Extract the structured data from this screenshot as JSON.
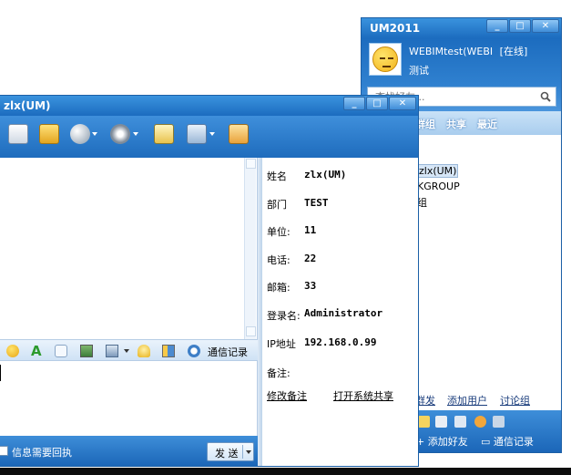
{
  "colors": {
    "title_blue": "#1c6cbf",
    "toolbar_blue": "#3f8fdb",
    "link": "#1a3d7c"
  },
  "um_window": {
    "title": "UM2011",
    "controls": [
      "_",
      "□",
      "✕"
    ],
    "user": {
      "name": "WEBIMtest(WEBI",
      "status": "[在线]",
      "signature": "测试"
    },
    "search_placeholder": "查找好友...",
    "tabs": [
      "群组",
      "共享",
      "最近"
    ],
    "tree": [
      {
        "label": "zlx(UM)",
        "selected": true
      },
      {
        "label": "KGROUP",
        "selected": false
      },
      {
        "label": "组",
        "selected": false
      }
    ],
    "links": [
      "群发",
      "添加用户",
      "讨论组"
    ],
    "bottom": {
      "add_friend": "添加好友",
      "chat_record": "通信记录"
    }
  },
  "chat_window": {
    "title": "zlx(UM)",
    "controls": [
      "_",
      "□",
      "✕"
    ],
    "toolbar_icons": [
      "document-icon",
      "folder-upload-icon",
      "magic-wand-icon",
      "webcam-icon",
      "whiteboard-icon",
      "remote-screen-icon",
      "add-contact-icon"
    ],
    "format_icons": [
      "emoticon-icon",
      "font-icon",
      "more-icon",
      "image-icon",
      "screenshot-icon",
      "bell-icon",
      "layout-icon",
      "history-icon"
    ],
    "chat_record_label": "通信记录",
    "receipt_label": "信息需要回执",
    "send_label": "发 送",
    "info": {
      "name_label": "姓名",
      "name_value": "zlx(UM)",
      "dept_label": "部门",
      "dept_value": "TEST",
      "unit_label": "单位:",
      "unit_value": "11",
      "phone_label": "电话:",
      "phone_value": "22",
      "email_label": "邮箱:",
      "email_value": "33",
      "login_label": "登录名:",
      "login_value": "Administrator",
      "ip_label": "IP地址",
      "ip_value": "192.168.0.99",
      "note_label": "备注:",
      "edit_note_link": "修改备注",
      "open_share_link": "打开系统共享"
    }
  }
}
